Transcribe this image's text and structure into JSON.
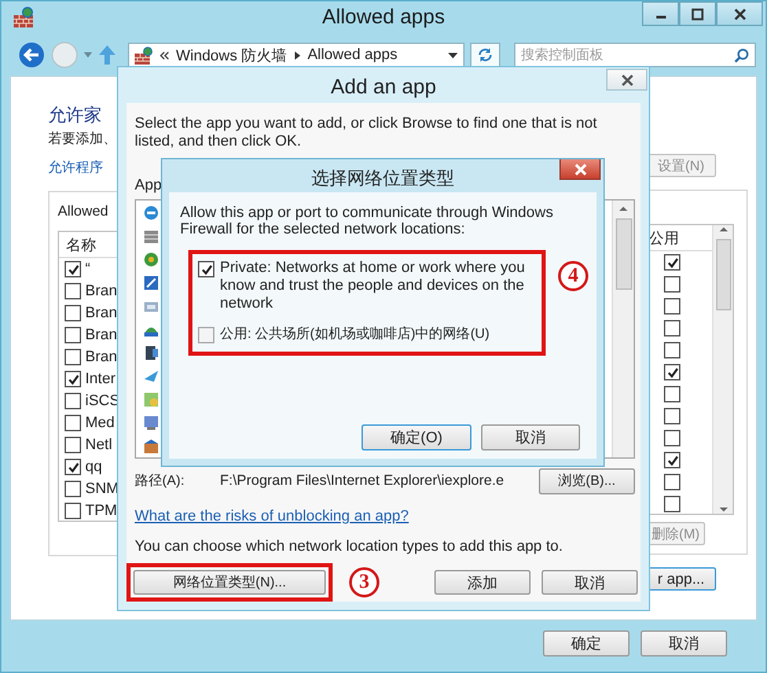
{
  "window": {
    "title": "Allowed apps",
    "breadcrumbs": [
      "Windows 防火墙",
      "Allowed apps"
    ],
    "search": {
      "placeholder": "搜索控制面板"
    }
  },
  "page": {
    "heading": "允许家",
    "instruction": "若要添加、",
    "link": "允许程序",
    "settings_button": "设置(N)",
    "allowed_group": {
      "label": "Allowed",
      "columns": [
        "名称",
        "公用"
      ],
      "rows": [
        {
          "name": "“",
          "checked": true,
          "public": true
        },
        {
          "name": "Bran",
          "checked": false,
          "public": false
        },
        {
          "name": "Bran",
          "checked": false,
          "public": false
        },
        {
          "name": "Bran",
          "checked": false,
          "public": false
        },
        {
          "name": "Bran",
          "checked": false,
          "public": false
        },
        {
          "name": "Inter",
          "checked": true,
          "public": true
        },
        {
          "name": "iSCS",
          "checked": false,
          "public": false
        },
        {
          "name": "Med",
          "checked": false,
          "public": false
        },
        {
          "name": "Netl",
          "checked": false,
          "public": false
        },
        {
          "name": "qq",
          "checked": true,
          "public": true
        },
        {
          "name": "SNM",
          "checked": false,
          "public": false
        },
        {
          "name": "TPM",
          "checked": false,
          "public": false
        }
      ]
    },
    "remove_button": "删除(M)",
    "allow_another_button": "r app..."
  },
  "buttons": [
    "确定",
    "取消"
  ],
  "add_dialog": {
    "title": "Add an app",
    "instruction": "Select the app you want to add, or click Browse to find one that is not listed, and then click OK.",
    "apps_label": "App",
    "path_label": "路径(A):",
    "path_value": "F:\\Program Files\\Internet Explorer\\iexplore.e",
    "browse_button": "浏览(B)...",
    "risk_link": "What are the risks of unblocking an app?",
    "network_note": "You can choose which network location types to add this app to.",
    "network_types_button": "网络位置类型(N)...",
    "step_number": "3",
    "add_button": "添加",
    "cancel_button": "取消"
  },
  "network_dialog": {
    "title": "选择网络位置类型",
    "instruction": "Allow this app or port to communicate through Windows Firewall for the selected network locations:",
    "options": [
      {
        "label": "Private:  Networks at home or work where you know and trust the people and devices on the network",
        "checked": true
      },
      {
        "label": "公用: 公共场所(如机场或咖啡店)中的网络(U)",
        "checked": false
      }
    ],
    "step_number": "4",
    "ok_button": "确定(O)",
    "cancel_button": "取消"
  }
}
